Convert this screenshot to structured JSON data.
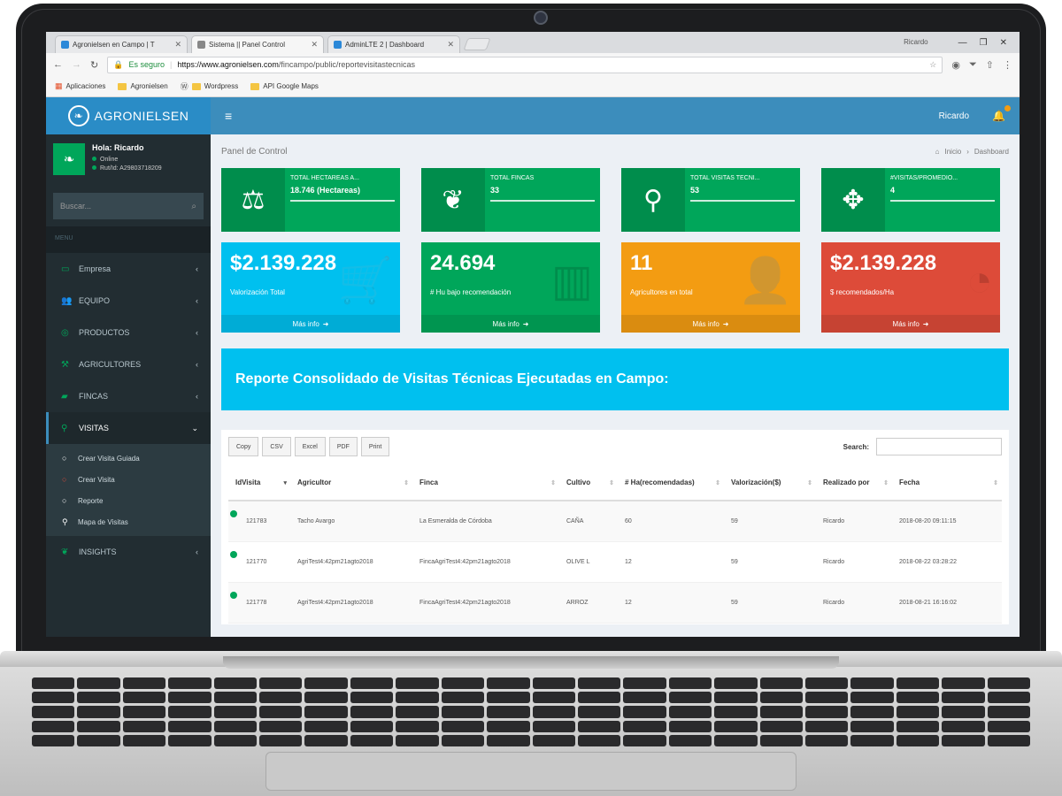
{
  "browser": {
    "tabs": [
      {
        "label": "Agronielsen en Campo | T"
      },
      {
        "label": "Sistema || Panel Control"
      },
      {
        "label": "AdminLTE 2 | Dashboard"
      }
    ],
    "window_user": "Ricardo",
    "secure_label": "Es seguro",
    "url_host": "https://www.agronielsen.com",
    "url_path": "/fincampo/public/reportevisitastecnicas",
    "bookmarks": [
      "Aplicaciones",
      "Agronielsen",
      "Wordpress",
      "API Google Maps"
    ]
  },
  "brand": {
    "logo_text": "AGRONIELSEN"
  },
  "topnav": {
    "user": "Ricardo"
  },
  "sidebar": {
    "user_name": "Hola: Ricardo",
    "status": "Online",
    "user_id": "Rut/Id: A29803718209",
    "search_placeholder": "Buscar...",
    "menu_header": "MENU",
    "items": [
      {
        "label": "Empresa",
        "icon": "briefcase-icon"
      },
      {
        "label": "EQUIPO",
        "icon": "users-icon"
      },
      {
        "label": "PRODUCTOS",
        "icon": "circle-icon"
      },
      {
        "label": "AGRICULTORES",
        "icon": "tractor-icon"
      },
      {
        "label": "FINCAS",
        "icon": "chart-icon"
      },
      {
        "label": "VISITAS",
        "icon": "map-marker-icon"
      }
    ],
    "submenu": [
      {
        "label": "Crear Visita Guiada",
        "icon": "circle-icon"
      },
      {
        "label": "Crear Visita",
        "icon": "circle-icon"
      },
      {
        "label": "Reporte",
        "icon": "circle-icon"
      },
      {
        "label": "Mapa de Visitas",
        "icon": "map-marker-icon"
      }
    ],
    "after": {
      "label": "INSIGHTS",
      "icon": "leaf-icon"
    }
  },
  "content": {
    "page_title": "Panel de Control",
    "breadcrumb_home": "Inicio",
    "breadcrumb_current": "Dashboard",
    "info_boxes": [
      {
        "label": "TOTAL HECTAREAS A...",
        "value": "18.746 (Hectareas)",
        "icon": "scale-icon"
      },
      {
        "label": "TOTAL FINCAS",
        "value": "33",
        "icon": "leaf-icon"
      },
      {
        "label": "TOTAL VISITAS TÉCNI...",
        "value": "53",
        "icon": "map-marker-icon"
      },
      {
        "label": "#VISITAS/PROMEDIO...",
        "value": "4",
        "icon": "crosshair-icon"
      }
    ],
    "small_boxes": [
      {
        "value": "$2.139.228",
        "label": "Valorización Total",
        "footer": "Más info",
        "color": "#00c0ef"
      },
      {
        "value": "24.694",
        "label": "# Hu bajo recomendación",
        "footer": "Más info",
        "color": "#00a65a"
      },
      {
        "value": "11",
        "label": "Agricultores en total",
        "footer": "Más info",
        "color": "#f39c12"
      },
      {
        "value": "$2.139.228",
        "label": "$ recomendados/Ha",
        "footer": "Más info",
        "color": "#dd4b39"
      }
    ],
    "report_title": "Reporte Consolidado de Visitas Técnicas Ejecutadas en Campo:",
    "table_tools": [
      "Copy",
      "CSV",
      "Excel",
      "PDF",
      "Print"
    ],
    "search_label": "Search:",
    "table": {
      "headers": [
        "IdVisita",
        "Agricultor",
        "Finca",
        "Cultivo",
        "# Ha(recomendadas)",
        "Valorización($)",
        "Realizado por",
        "Fecha"
      ],
      "rows": [
        [
          "121783",
          "Tacho Avargo",
          "La Esmeralda de Córdoba",
          "CAÑA",
          "60",
          "59",
          "Ricardo",
          "2018-08-20 09:11:15"
        ],
        [
          "121770",
          "AgriTest4:42pm21agto2018",
          "FincaAgriTest4:42pm21agto2018",
          "OLIVE L",
          "12",
          "59",
          "Ricardo",
          "2018-08-22 03:28:22"
        ],
        [
          "121778",
          "AgriTest4:42pm21agto2018",
          "FincaAgriTest4:42pm21agto2018",
          "ARROZ",
          "12",
          "59",
          "Ricardo",
          "2018-08-21 16:16:02"
        ]
      ]
    }
  },
  "colors": {
    "brand_blue": "#3c8dbc",
    "sidebar_dark": "#222d32",
    "green": "#00a65a",
    "aqua": "#00c0ef",
    "yellow": "#f39c12",
    "red": "#dd4b39"
  }
}
